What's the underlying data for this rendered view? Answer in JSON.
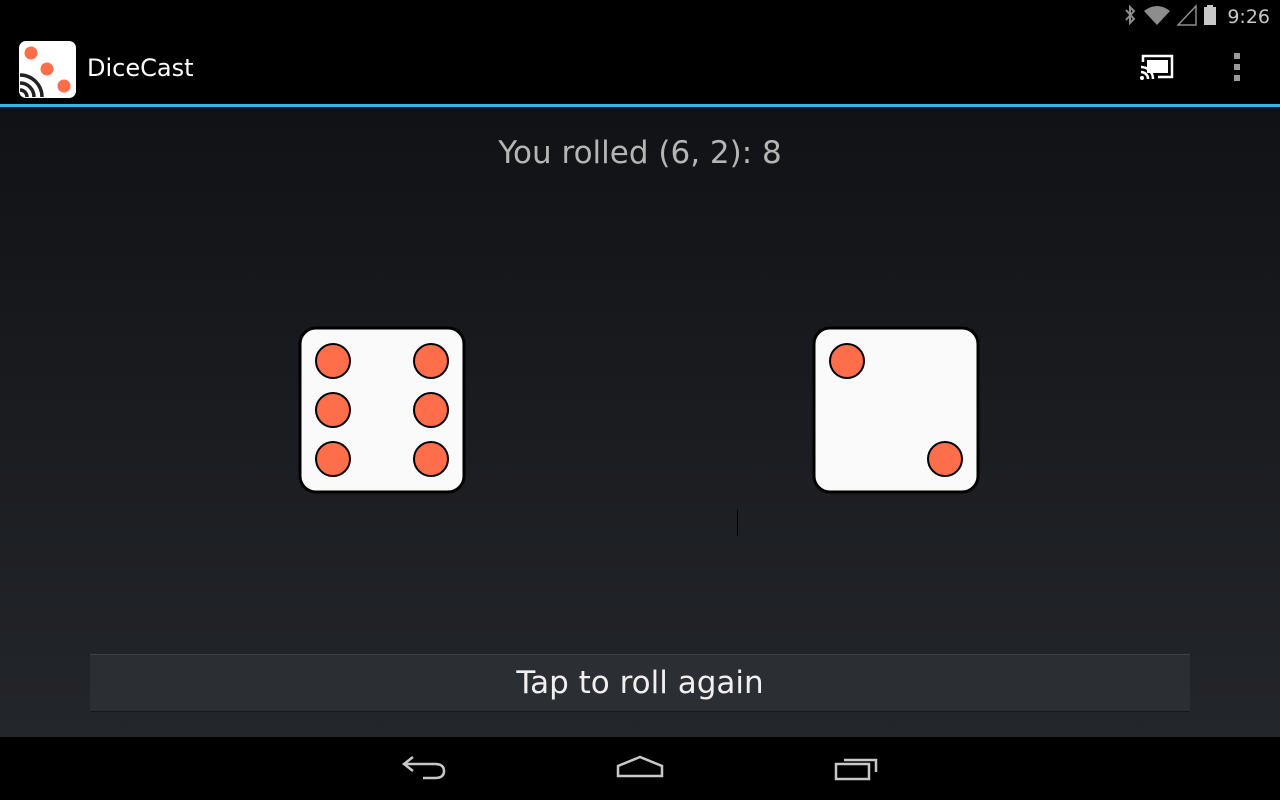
{
  "status_bar": {
    "time": "9:26",
    "icons": [
      "bluetooth-icon",
      "wifi-icon",
      "signal-icon",
      "battery-icon"
    ]
  },
  "action_bar": {
    "title": "DiceCast",
    "actions": [
      "cast-icon",
      "overflow-menu-icon"
    ],
    "accent_color": "#33b5e5"
  },
  "main": {
    "result_text": "You rolled (6, 2): 8",
    "dice": [
      {
        "value": 6
      },
      {
        "value": 2
      }
    ],
    "pip_color": "#ff6e4a",
    "roll_button_label": "Tap to roll again"
  },
  "nav_bar": {
    "buttons": [
      "back-icon",
      "home-icon",
      "recents-icon"
    ]
  }
}
